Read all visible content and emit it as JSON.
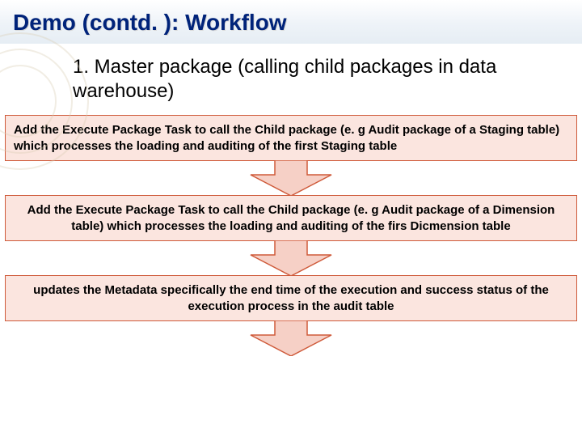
{
  "header": {
    "title": "Demo (contd. ): Workflow"
  },
  "subtitle": "1. Master package (calling child packages in data warehouse)",
  "steps": [
    {
      "text": "Add the Execute Package Task to call the Child package (e. g Audit package of a Staging table) which processes the loading and auditing of the first Staging table",
      "align": "left"
    },
    {
      "text": "Add the Execute Package Task to call the Child package (e. g Audit package of a Dimension table) which processes the loading and auditing of the firs Dicmension table",
      "align": "center"
    },
    {
      "text": "updates the Metadata specifically the end time of the execution and success status of the execution process in the audit table",
      "align": "center"
    }
  ],
  "colors": {
    "title": "#00237a",
    "box_bg": "#fbe5df",
    "box_border": "#cf5a3a",
    "arrow_fill": "#f6d0c6",
    "arrow_stroke": "#cf5a3a"
  }
}
